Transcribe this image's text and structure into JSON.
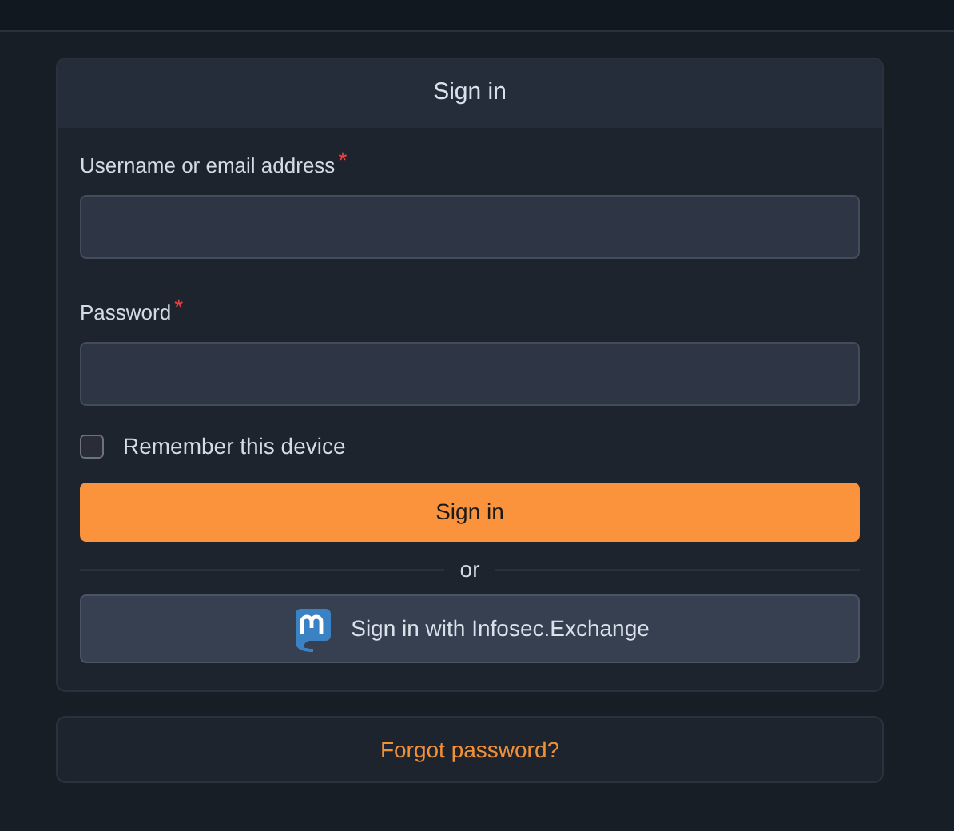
{
  "card": {
    "title": "Sign in"
  },
  "fields": [
    {
      "label": "Username or email address",
      "required_mark": "*"
    },
    {
      "label": "Password",
      "required_mark": "*"
    }
  ],
  "remember": {
    "label": "Remember this device",
    "checked": false
  },
  "submit": {
    "label": "Sign in"
  },
  "divider": {
    "label": "or"
  },
  "provider_button": {
    "label": "Sign in with Infosec.Exchange"
  },
  "forgot_link": {
    "label": "Forgot password?"
  }
}
